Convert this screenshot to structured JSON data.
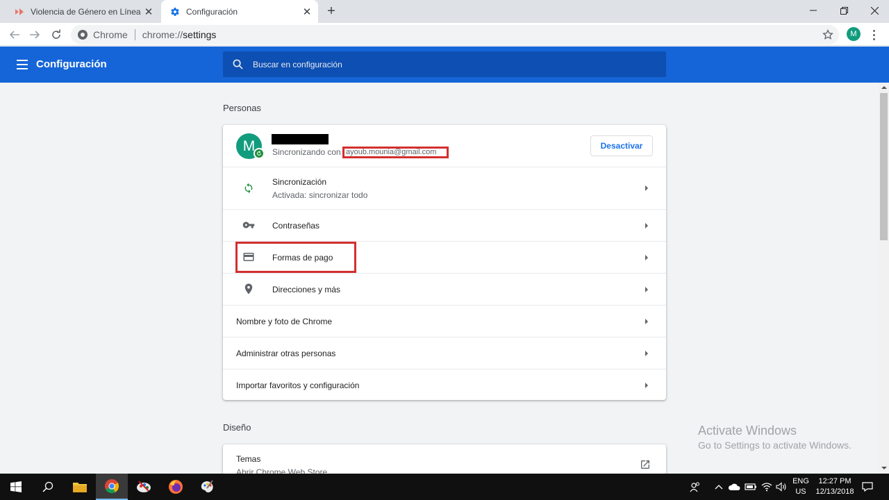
{
  "browser": {
    "tabs": [
      {
        "title": "Violencia de Género en Línea | Pl",
        "active": false
      },
      {
        "title": "Configuración",
        "active": true
      }
    ],
    "omnibox": {
      "chip": "Chrome",
      "url_scheme": "chrome://",
      "url_path": "settings"
    },
    "profile_initial": "M"
  },
  "header": {
    "title": "Configuración",
    "search_placeholder": "Buscar en configuración"
  },
  "personas": {
    "section_title": "Personas",
    "account": {
      "avatar_initial": "M",
      "sync_status": "Sincronizando con",
      "email": "ayoub.mounia@gmail.com",
      "deactivate_label": "Desactivar"
    },
    "rows": {
      "sync_label": "Sincronización",
      "sync_sub": "Activada: sincronizar todo",
      "passwords": "Contraseñas",
      "payments": "Formas de pago",
      "addresses": "Direcciones y más",
      "name_photo": "Nombre y foto de Chrome",
      "manage_people": "Administrar otras personas",
      "import": "Importar favoritos y configuración"
    }
  },
  "diseno": {
    "section_title": "Diseño",
    "themes_label": "Temas",
    "themes_sub": "Abrir Chrome Web Store"
  },
  "watermark": {
    "line1": "Activate Windows",
    "line2": "Go to Settings to activate Windows."
  },
  "taskbar": {
    "lang_top": "ENG",
    "lang_bottom": "US",
    "time": "12:27 PM",
    "date": "12/13/2018"
  },
  "icons": [
    "windows-start-icon",
    "search-icon",
    "file-explorer-icon",
    "chrome-icon",
    "firefox-icon",
    "key-icon",
    "credit-card-icon",
    "location-pin-icon",
    "sync-icon",
    "external-link-icon"
  ]
}
